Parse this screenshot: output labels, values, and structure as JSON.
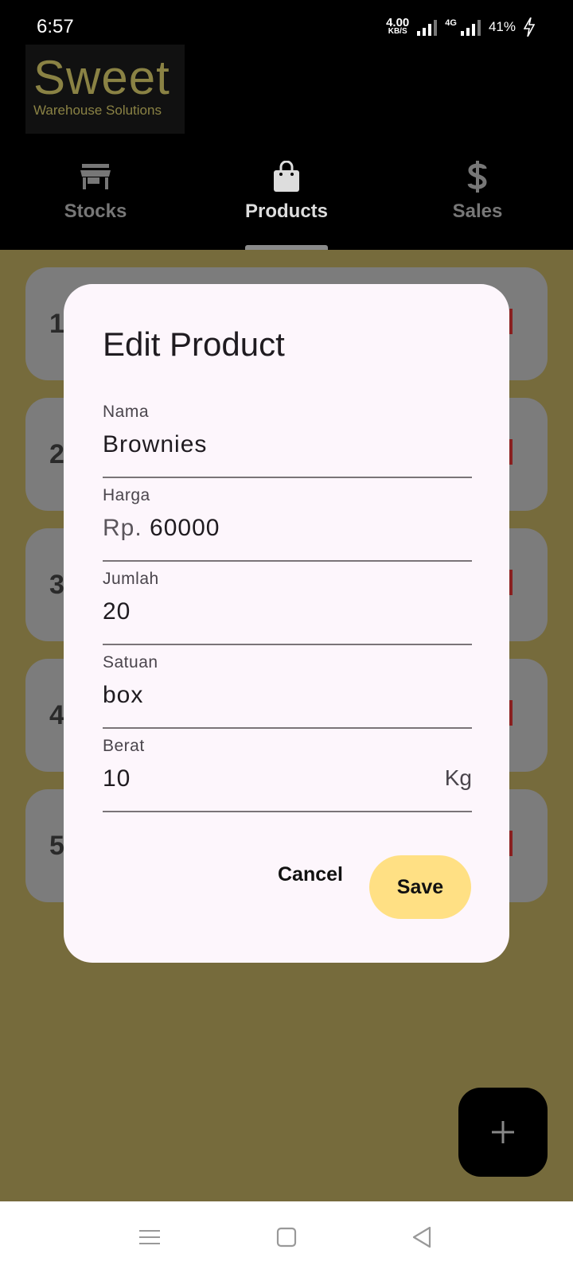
{
  "status_bar": {
    "time": "6:57",
    "net_speed_value": "4.00",
    "net_speed_unit": "KB/S",
    "network_type": "4G",
    "battery": "41%"
  },
  "logo": {
    "title": "Sweet",
    "subtitle": "Warehouse Solutions"
  },
  "tabs": [
    {
      "label": "Stocks",
      "icon": "store-icon",
      "active": false
    },
    {
      "label": "Products",
      "icon": "shopping-bag-icon",
      "active": true
    },
    {
      "label": "Sales",
      "icon": "dollar-icon",
      "active": false
    }
  ],
  "list": {
    "items": [
      {
        "number": "1"
      },
      {
        "number": "2"
      },
      {
        "number": "3"
      },
      {
        "number": "4"
      },
      {
        "number": "5"
      }
    ]
  },
  "dialog": {
    "title": "Edit Product",
    "fields": [
      {
        "label": "Nama",
        "value": "Brownies"
      },
      {
        "label": "Harga",
        "prefix": "Rp. ",
        "value": "60000"
      },
      {
        "label": "Jumlah",
        "value": "20"
      },
      {
        "label": "Satuan",
        "value": "box"
      },
      {
        "label": "Berat",
        "value": "10",
        "suffix": "Kg"
      }
    ],
    "cancel_label": "Cancel",
    "save_label": "Save"
  },
  "fab": {
    "icon": "plus-icon"
  },
  "colors": {
    "background": "#766b3c",
    "accent": "#ffe084",
    "logo": "#8a8244",
    "delete": "#8a2020"
  }
}
